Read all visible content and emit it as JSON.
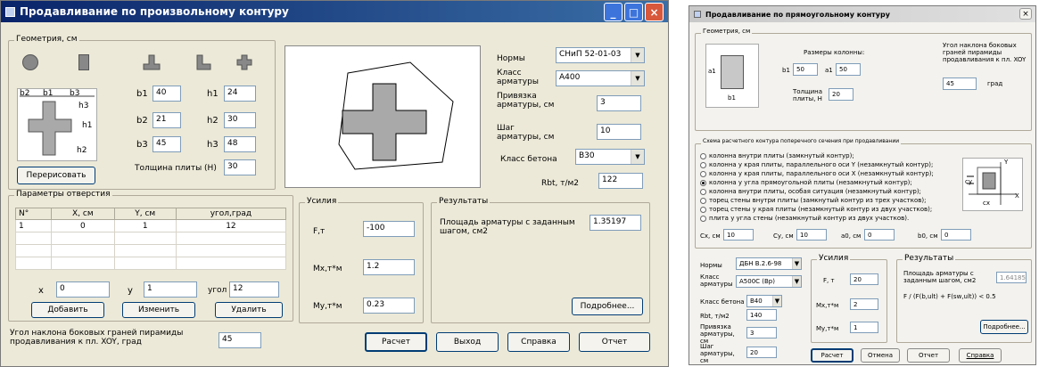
{
  "left": {
    "title": "Продавливание по произвольному контуру",
    "geometry_group": "Геометрия, см",
    "shape_icons": [
      "circle-column-icon",
      "rect-column-icon",
      "t-column-icon",
      "l-column-icon",
      "cross-column-icon"
    ],
    "sketch_labels": {
      "b2": "b2",
      "b1": "b1",
      "b3": "b3",
      "h3": "h3",
      "h1": "h1",
      "h2": "h2"
    },
    "fields": [
      {
        "label": "b1",
        "value": "40"
      },
      {
        "label": "h1",
        "value": "24"
      },
      {
        "label": "b2",
        "value": "21"
      },
      {
        "label": "h2",
        "value": "30"
      },
      {
        "label": "b3",
        "value": "45"
      },
      {
        "label": "h3",
        "value": "48"
      }
    ],
    "redraw_button": "Перерисовать",
    "slab_label": "Толщина плиты (H)",
    "slab_value": "30",
    "norms_label": "Нормы",
    "norms_value": "СНиП 52-01-03",
    "rebar_class_label": "Класс арматуры",
    "rebar_class_value": "A400",
    "cover_label": "Привязка арматуры, см",
    "cover_value": "3",
    "step_label": "Шаг арматуры, см",
    "step_value": "10",
    "concrete_label": "Класс бетона",
    "concrete_value": "B30",
    "rbt_label": "Rbt, т/м2",
    "rbt_value": "122",
    "openings_group": "Параметры отверстия",
    "table_headers": [
      "N°",
      "X, см",
      "Y, см",
      "угол,град"
    ],
    "table_rows": [
      [
        "1",
        "0",
        "1",
        "12"
      ]
    ],
    "x_label": "x",
    "x_value": "0",
    "y_label": "y",
    "y_value": "1",
    "angle_label": "угол",
    "angle_value": "12",
    "add_button": "Добавить",
    "edit_button": "Изменить",
    "delete_button": "Удалить",
    "forces_group": "Усилия",
    "f_label": "F,т",
    "f_value": "-100",
    "mx_label": "Mx,т*м",
    "mx_value": "1.2",
    "my_label": "My,т*м",
    "my_value": "0.23",
    "results_group": "Результаты",
    "area_label": "Площадь арматуры с заданным шагом, см2",
    "area_value": "1.35197",
    "details_button": "Подробнее...",
    "slope_label": "Угол наклона боковых граней пирамиды продавливания к пл. XOY, град",
    "slope_value": "45",
    "calc_button": "Расчет",
    "exit_button": "Выход",
    "help_button": "Справка",
    "report_button": "Отчет"
  },
  "right": {
    "title": "Продавливание по прямоугольному контуру",
    "geometry_group": "Геометрия, см",
    "col_sizes_label": "Размеры колонны:",
    "b1_label": "b1",
    "b1_value": "50",
    "a1_label": "a1",
    "a1_value": "50",
    "sketch_a1": "a1",
    "sketch_b1": "b1",
    "slab_label": "Толщина плиты, H",
    "slab_value": "20",
    "slope_label": "Угол наклона боковых граней пирамиды продавливания к пл. XOY",
    "slope_value": "45",
    "slope_unit": "град",
    "scheme_group": "Схема расчетного контура поперечного сечения при продавливании",
    "scheme_options": [
      {
        "label": "колонна внутри плиты (замкнутый контур);",
        "on": false
      },
      {
        "label": "колонна у края плиты, параллельного оси Y (незамкнутый контур);",
        "on": false
      },
      {
        "label": "колонна у края плиты, параллельного оси X (незамкнутый контур);",
        "on": false
      },
      {
        "label": "колонна у угла прямоугольной плиты (незамкнутый контур);",
        "on": true
      },
      {
        "label": "колонна внутри плиты, особая ситуация (незамкнутый контур);",
        "on": false
      },
      {
        "label": "торец стены внутри плиты (замкнутый контур из трех участков);",
        "on": false
      },
      {
        "label": "торец стены у края плиты (незамкнутый контур из двух участков);",
        "on": false
      },
      {
        "label": "плита у угла стены (незамкнутый контур из двух участков).",
        "on": false
      }
    ],
    "cx_label": "Cx, см",
    "cx_value": "10",
    "cy_label": "Cy, см",
    "cy_value": "10",
    "a0_label": "a0, см",
    "a0_value": "0",
    "b0_label": "b0, см",
    "b0_value": "0",
    "diag_labels": {
      "y": "Y",
      "x": "X",
      "cy": "cy",
      "cx": "cx"
    },
    "norms_label": "Нормы",
    "norms_value": "ДБН В.2.6-98",
    "rebar_label": "Класс арматуры",
    "rebar_value": "A500С (Вр)",
    "concrete_label": "Класс бетона",
    "concrete_value": "B40",
    "rbt_label": "Rbt, т/м2",
    "rbt_value": "140",
    "cover_label": "Привязка арматуры, см",
    "cover_value": "3",
    "step_label": "Шаг арматуры, см",
    "step_value": "20",
    "forces_group": "Усилия",
    "f_label": "F, т",
    "f_value": "20",
    "mx_label": "Mx,т*м",
    "mx_value": "2",
    "my_label": "My,т*м",
    "my_value": "1",
    "results_group": "Результаты",
    "area_label": "Площадь арматуры с заданным шагом, см2",
    "area_value": "1.64185",
    "ratio_label": "F / (F(b,ult) + F(sw,ult)) < 0.5",
    "details_button": "Подробнее...",
    "calc_button": "Расчет",
    "exit_button": "Отмена",
    "report_button": "Отчет",
    "help_button": "Справка"
  },
  "colors": {
    "titlebar": "#0a246a",
    "titlebar_end": "#3a6ea5",
    "window": "#ece9d8",
    "shape": "#a9a9a9"
  }
}
